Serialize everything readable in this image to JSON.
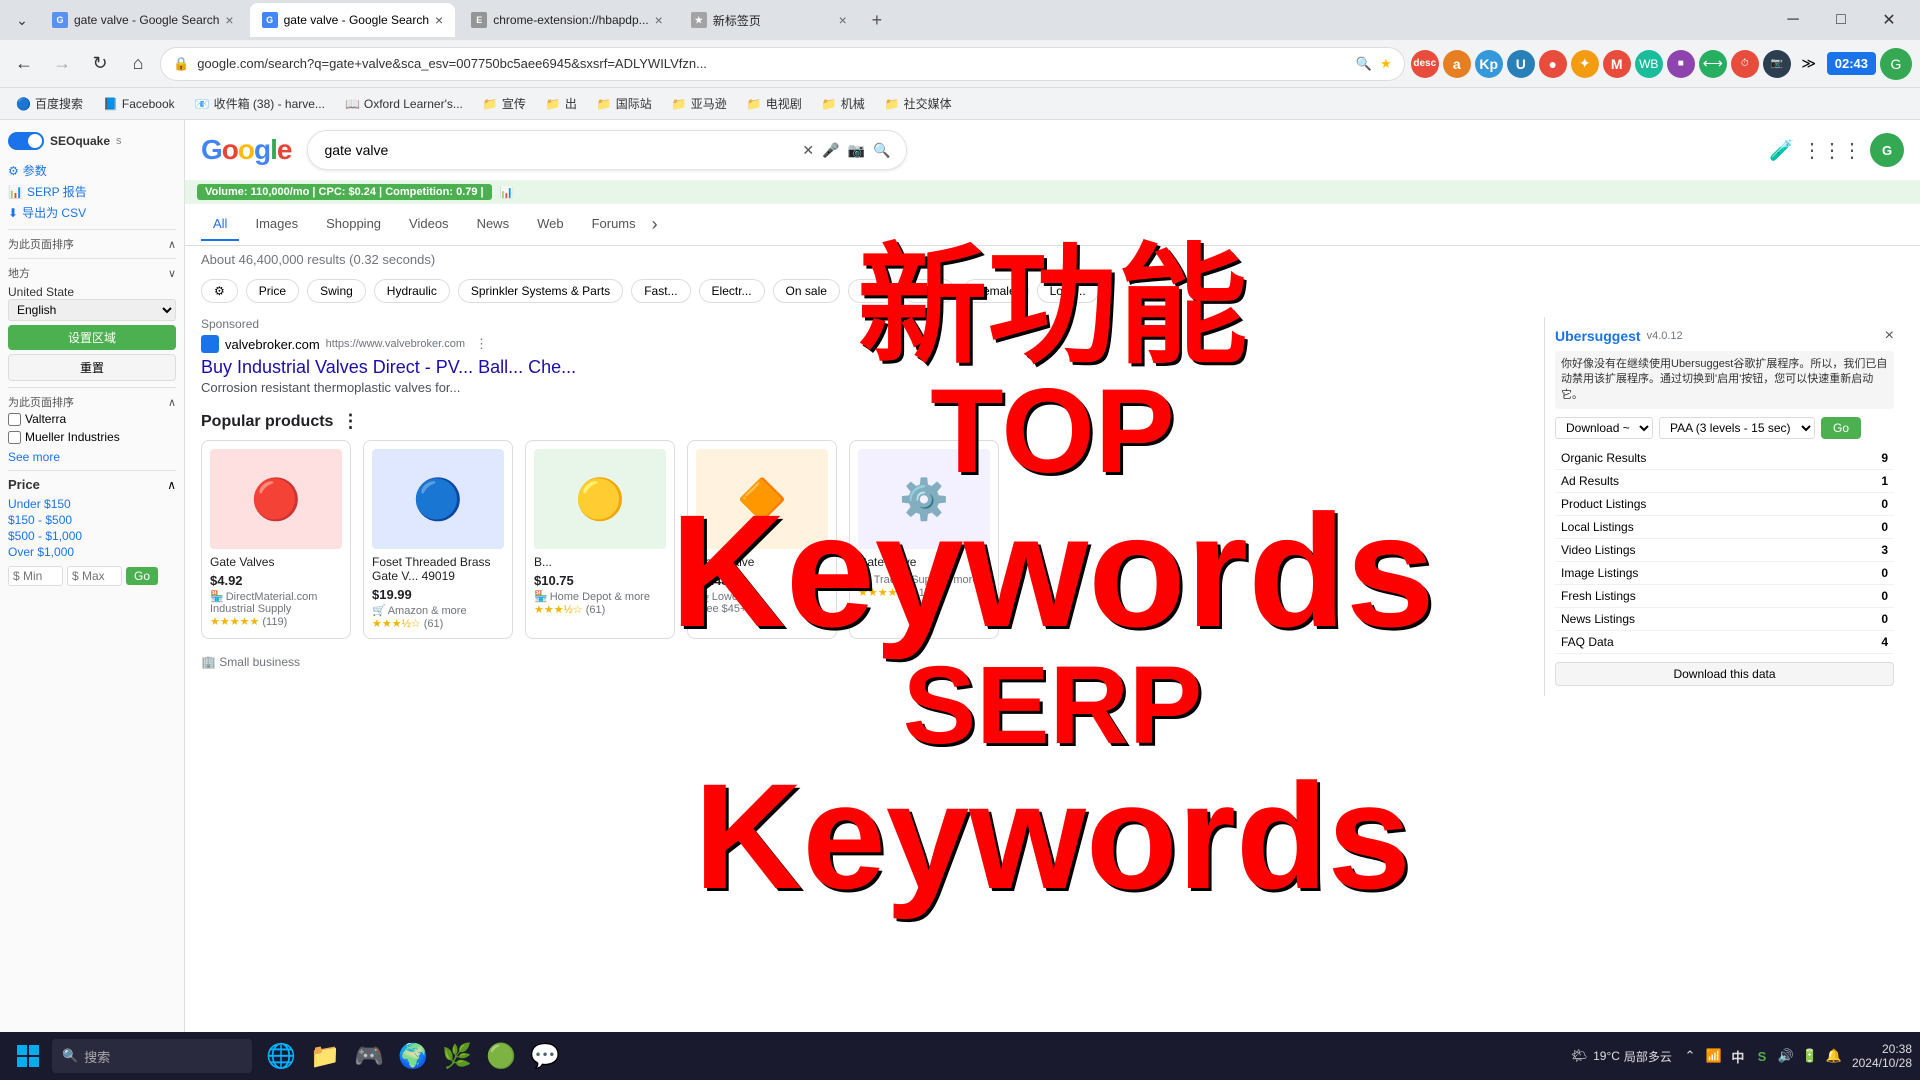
{
  "browser": {
    "tabs": [
      {
        "id": "tab1",
        "label": "gate valve - Google Search",
        "favicon": "G",
        "active": false
      },
      {
        "id": "tab2",
        "label": "gate valve - Google Search",
        "favicon": "G",
        "active": true
      },
      {
        "id": "tab3",
        "label": "chrome-extension://hbapdp...",
        "favicon": "E",
        "active": false
      },
      {
        "id": "tab4",
        "label": "新标签页",
        "favicon": "★",
        "active": false
      }
    ],
    "address": "google.com/search?q=gate+valve&sca_esv=007750bc5aee6945&sxsrf=ADLYWILVfzn...",
    "clock": "02:43"
  },
  "bookmarks": [
    "百度搜索",
    "Facebook",
    "收件箱 (38) - harve...",
    "Oxford Learner's...",
    "宣传",
    "出",
    "国际站",
    "亚马逊",
    "电视剧",
    "机械",
    "社交媒体"
  ],
  "seoquake": {
    "toggle_label": "SEOquake",
    "toggle_state": "on",
    "items": [
      {
        "label": "参数"
      },
      {
        "label": "SERP 报告"
      },
      {
        "label": "导出为 CSV"
      }
    ],
    "section_label": "为此页面排序",
    "location_label": "地方",
    "country_label": "United State",
    "language_label": "English",
    "btn_set_region": "设置区域",
    "btn_reset": "重置",
    "checkboxes": [
      {
        "label": "Valterra"
      },
      {
        "label": "Mueller Industries"
      }
    ],
    "see_more": "See more",
    "price_title": "Price",
    "price_items": [
      "Under $150",
      "$150 - $500",
      "$500 - $1,000",
      "Over $1,000"
    ],
    "price_min_placeholder": "$ Min",
    "price_max_placeholder": "$ Max",
    "price_go": "Go"
  },
  "google": {
    "logo_text": "Google",
    "search_query": "gate valve",
    "results_info": "About 46,400,000 results (0.32 seconds)",
    "tabs": [
      "All",
      "Images",
      "Shopping",
      "Videos",
      "News",
      "Web",
      "Forums"
    ],
    "active_tab": "All",
    "volume_badge": "Volume: 110,000/mo | CPC: $0.24 | Competition: 0.79 |",
    "filters": [
      "Price",
      "Swing",
      "Hydraulic",
      "Sprinkler Systems & Parts",
      "Fast...",
      "Electr...",
      "On sale",
      "Buy",
      "Male",
      "Female",
      "Loca..."
    ],
    "sponsored_label": "Sponsored",
    "ad": {
      "domain": "valvebroker.com",
      "url": "https://www.valvebroker.com",
      "title": "Buy Industrial Valves Direct - PV... Ball... Che...",
      "desc": "Corrosion resistant thermoplastic valves for..."
    },
    "popular_products_title": "Popular products",
    "products": [
      {
        "name": "Gate Valves",
        "price": "$4.92",
        "source": "DirectMaterial.com",
        "source_type": "Industrial Supply",
        "rating": "4.8",
        "reviews": "119",
        "stars": "★★★★★"
      },
      {
        "name": "Foset Threaded Brass Gate V... 49019",
        "price": "$19.99",
        "source": "Amazon & more",
        "rating": "3.6",
        "reviews": "61",
        "stars": "★★★½☆"
      },
      {
        "name": "B...",
        "price": "$10.75",
        "source": "Home Depot & more",
        "rating": "3.6",
        "reviews": "61",
        "stars": "★★★½☆"
      },
      {
        "name": "Gate Valve",
        "price": "$9.48",
        "source": "Lowe's",
        "note": "Free $45+",
        "rating": "",
        "reviews": "",
        "stars": ""
      },
      {
        "name": "Gate Valve",
        "price": "",
        "source": "Tractor Sup... & more",
        "rating": "4.6",
        "reviews": "11",
        "stars": "★★★★½"
      }
    ]
  },
  "ubersuggest": {
    "logo": "Ubersuggest",
    "version": "v4.0.12",
    "notice": "你好像没有在继续使用Ubersuggest谷歌扩展程序。所以，我们已自动禁用该扩展程序。通过切换到'启用'按钮，您可以快速重新启动它。",
    "dropdown_label": "PAA (3 levels - 15 sec)",
    "download_label": "Download ~",
    "go_label": "Go",
    "close_label": "×",
    "metrics": [
      {
        "label": "Organic Results",
        "value": "9"
      },
      {
        "label": "Ad Results",
        "value": "1"
      },
      {
        "label": "Product Listings",
        "value": "0"
      },
      {
        "label": "Local Listings",
        "value": "0"
      },
      {
        "label": "Video Listings",
        "value": "3"
      },
      {
        "label": "Image Listings",
        "value": "0"
      },
      {
        "label": "Fresh Listings",
        "value": "0"
      },
      {
        "label": "News Listings",
        "value": "0"
      },
      {
        "label": "FAQ Data",
        "value": "4"
      }
    ],
    "download_data_label": "Download this data"
  },
  "overlay": {
    "line1": "新功能",
    "line2": "TOP",
    "line3": "Keywords",
    "line4": "SERP",
    "line5": "Keywords"
  },
  "taskbar": {
    "search_placeholder": "搜索",
    "time": "20:38",
    "date": "2024/10/28",
    "temperature": "19°C",
    "weather": "局部多云",
    "apps": [
      "🌐",
      "📁",
      "🎮",
      "🌍",
      "🌿",
      "🟢",
      "💬"
    ]
  }
}
